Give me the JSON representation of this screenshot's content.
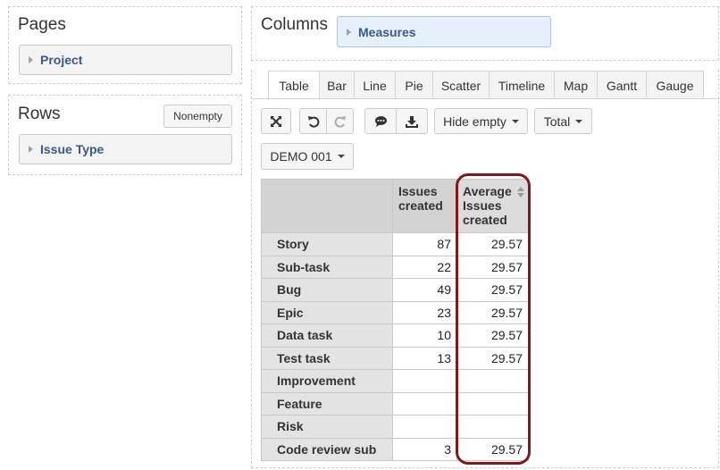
{
  "pages": {
    "title": "Pages",
    "chip": "Project"
  },
  "rows": {
    "title": "Rows",
    "nonempty_label": "Nonempty",
    "chip": "Issue Type"
  },
  "columns": {
    "title": "Columns",
    "chip": "Measures"
  },
  "tabs": [
    "Table",
    "Bar",
    "Line",
    "Pie",
    "Scatter",
    "Timeline",
    "Map",
    "Gantt",
    "Gauge"
  ],
  "toolbar": {
    "fullscreen_icon": "expand-icon",
    "undo_icon": "undo-icon",
    "redo_icon": "redo-icon",
    "comment_icon": "comment-icon",
    "export_icon": "download-icon",
    "hide_empty_label": "Hide empty",
    "total_label": "Total",
    "page_select_value": "DEMO 001"
  },
  "table": {
    "headers": [
      "Issues created",
      "Average Issues created"
    ],
    "rows": [
      {
        "label": "Story",
        "issues": "87",
        "avg": "29.57"
      },
      {
        "label": "Sub-task",
        "issues": "22",
        "avg": "29.57"
      },
      {
        "label": "Bug",
        "issues": "49",
        "avg": "29.57"
      },
      {
        "label": "Epic",
        "issues": "23",
        "avg": "29.57"
      },
      {
        "label": "Data task",
        "issues": "10",
        "avg": "29.57"
      },
      {
        "label": "Test task",
        "issues": "13",
        "avg": "29.57"
      },
      {
        "label": "Improvement",
        "issues": "",
        "avg": ""
      },
      {
        "label": "Feature",
        "issues": "",
        "avg": ""
      },
      {
        "label": "Risk",
        "issues": "",
        "avg": ""
      },
      {
        "label": "Code review sub",
        "issues": "3",
        "avg": "29.57"
      }
    ]
  },
  "colors": {
    "highlight": "#7e1a1a",
    "link": "#3a5a85"
  }
}
